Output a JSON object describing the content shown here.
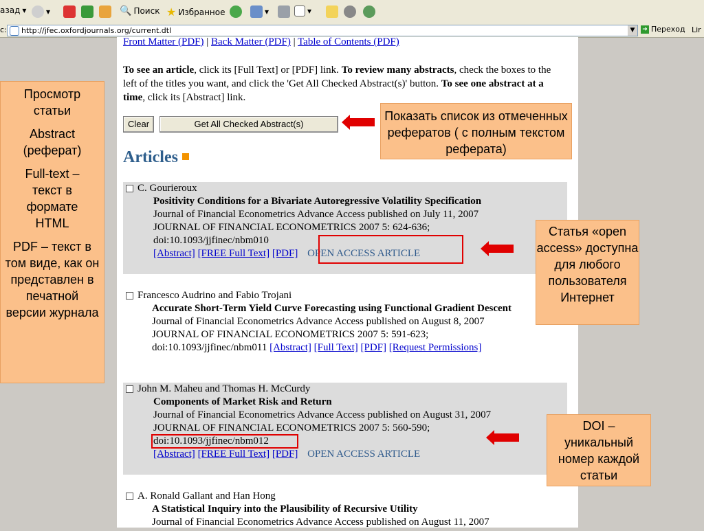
{
  "toolbar": {
    "back_label": "азад",
    "search_label": "Поиск",
    "favorites_label": "Избранное"
  },
  "address": {
    "prefix": "с:",
    "url": "http://jfec.oxfordjournals.org/current.dtl",
    "go_label": "Переход",
    "links_label": "Lir"
  },
  "page": {
    "topnav": [
      "Front Matter (PDF)",
      "Back Matter (PDF)",
      "Table of Contents (PDF)"
    ],
    "instructions": {
      "p1_bold": "To see an article",
      "p1_rest": ", click its [Full Text] or [PDF] link. ",
      "p2_bold": "To review many abstracts",
      "p2_rest": ", check the boxes to the left of the titles you want, and click the 'Get All Checked Abstract(s)' button. ",
      "p3_bold": "To see one abstract at a time",
      "p3_rest": ", click its [Abstract] link."
    },
    "clear_button": "Clear",
    "get_abstracts_button": "Get All Checked Abstract(s)",
    "articles_heading": "Articles",
    "articles": [
      {
        "authors": "C. Gourieroux",
        "title": "Positivity Conditions for a Bivariate Autoregressive Volatility Specification",
        "journal_line": "Journal of Financial Econometrics Advance Access published on July 11, 2007",
        "citation": "JOURNAL OF FINANCIAL ECONOMETRICS 2007 5: 624-636;",
        "doi": "doi:10.1093/jjfinec/nbm010",
        "links": [
          "[Abstract]",
          "[FREE Full Text]",
          "[PDF]"
        ],
        "open_access": "OPEN ACCESS ARTICLE"
      },
      {
        "authors": "Francesco Audrino and Fabio Trojani",
        "title": "Accurate Short-Term Yield Curve Forecasting using Functional Gradient Descent",
        "journal_line": "Journal of Financial Econometrics Advance Access published on August 8, 2007",
        "citation": "JOURNAL OF FINANCIAL ECONOMETRICS 2007 5: 591-623;",
        "doi": "doi:10.1093/jjfinec/nbm011",
        "links": [
          "[Abstract]",
          "[Full Text]",
          "[PDF]",
          "[Request Permissions]"
        ]
      },
      {
        "authors": "John M. Maheu and Thomas H. McCurdy",
        "title": "Components of Market Risk and Return",
        "journal_line": "Journal of Financial Econometrics Advance Access published on August 31, 2007",
        "citation": "JOURNAL OF FINANCIAL ECONOMETRICS 2007 5: 560-590;",
        "doi": "doi:10.1093/jjfinec/nbm012",
        "links": [
          "[Abstract]",
          "[FREE Full Text]",
          "[PDF]"
        ],
        "open_access": "OPEN ACCESS ARTICLE"
      },
      {
        "authors": "A. Ronald Gallant and Han Hong",
        "title": "A Statistical Inquiry into the Plausibility of Recursive Utility",
        "journal_line": "Journal of Financial Econometrics Advance Access published on August 11, 2007"
      }
    ]
  },
  "callouts": {
    "left": [
      "Просмотр статьи",
      "Abstract (реферат)",
      "Full-text – текст в формате HTML",
      "PDF – текст в том виде, как он представлен в печатной версии журнала"
    ],
    "checked_list": "Показать список из отмеченных рефератов ( с полным текстом реферата)",
    "open_access": "Статья «open access» доступна для любого пользователя Интернет",
    "doi": "DOI – уникальный номер каждой статьи"
  },
  "colors": {
    "callout_bg": "#fbc08a",
    "arrow": "#e00000",
    "link": "#0000cc",
    "heading": "#2e5e8c"
  }
}
